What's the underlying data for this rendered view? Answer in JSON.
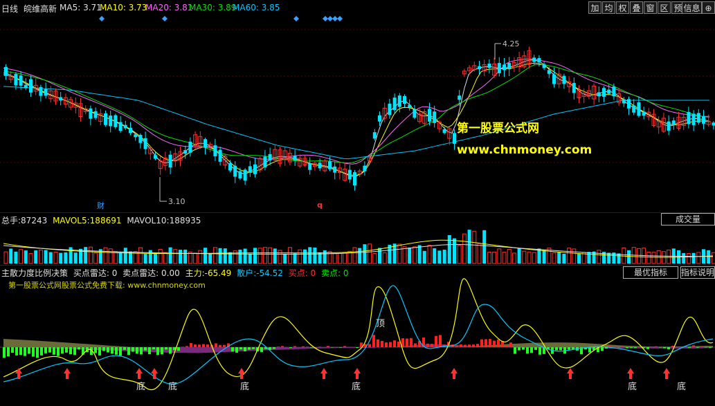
{
  "header": {
    "period": "日线",
    "stock_name": "皖维高新",
    "ma": [
      {
        "label": "MA5:",
        "value": "3.71",
        "color": "#e0e0e0"
      },
      {
        "label": "MA10:",
        "value": "3.73",
        "color": "#ffff00"
      },
      {
        "label": "MA20:",
        "value": "3.81",
        "color": "#ff66ff"
      },
      {
        "label": "MA30:",
        "value": "3.89",
        "color": "#00e000"
      },
      {
        "label": "MA60:",
        "value": "3.85",
        "color": "#00c8ff"
      }
    ],
    "toolbar": [
      "加",
      "均",
      "权",
      "叠",
      "窗",
      "区",
      "预",
      "信息",
      "⊕"
    ]
  },
  "price_chart": {
    "high_label": "4.25",
    "low_label": "3.10",
    "marker_cai": "财",
    "marker_q": "q",
    "watermark_title": "第一股票公式网",
    "watermark_url": "www.chnmoney.com"
  },
  "volume": {
    "total_label": "总手:",
    "total_value": "87243",
    "mavol5_label": "MAVOL5:",
    "mavol5_value": "188691",
    "mavol10_label": "MAVOL10:",
    "mavol10_value": "188935",
    "button": "成交量"
  },
  "indicator": {
    "name": "主散力度比例决策",
    "buy_radar": "买点雷达: 0",
    "sell_radar": "卖点雷达: 0.00",
    "main_label": "主力:",
    "main_value": "-65.49",
    "retail_label": "散户:",
    "retail_value": "-54.52",
    "buy_point": "买点: 0",
    "sell_point": "卖点: 0",
    "subtitle": "第一股票公式网股票公式免费下载: www.chnmoney.com",
    "btn_best": "最优指标",
    "btn_desc": "指标说明",
    "top_label": "顶",
    "bottom_label": "底"
  },
  "colors": {
    "up": "#ff3030",
    "down": "#00e5ff",
    "ma5": "#e0e0e0",
    "ma10": "#ffff00",
    "ma20": "#ff66ff",
    "ma30": "#00e000",
    "ma60": "#00c8ff"
  }
}
